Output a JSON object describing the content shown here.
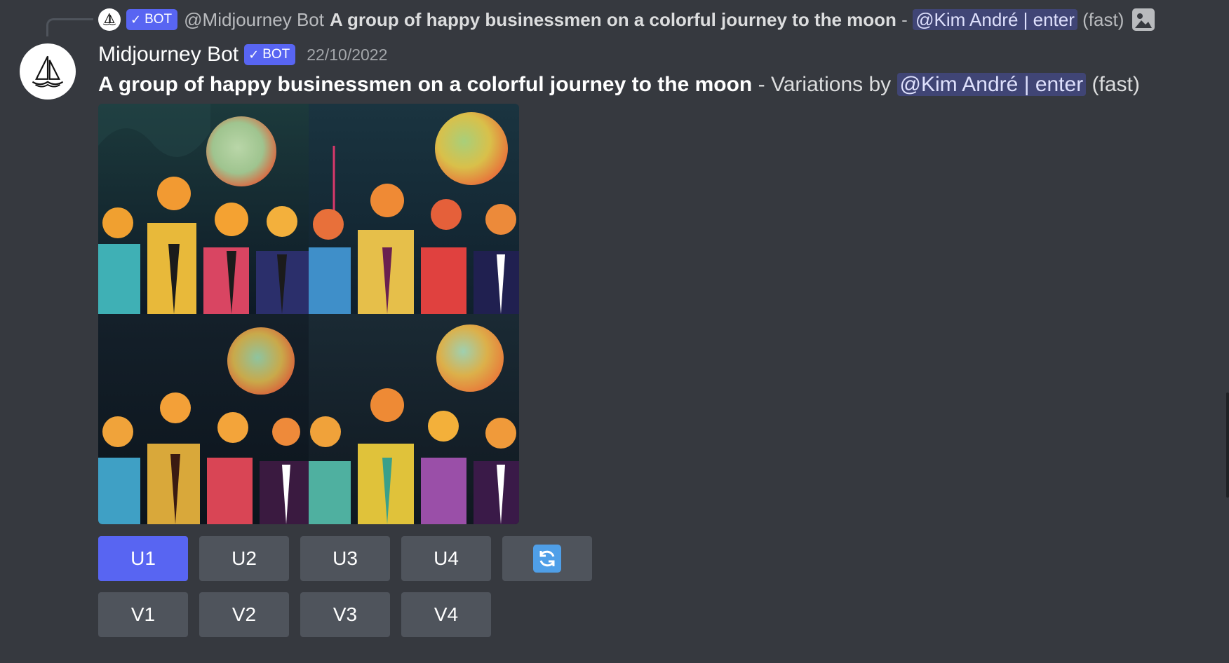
{
  "reply": {
    "bot_badge": "BOT",
    "author": "@Midjourney Bot",
    "prompt": "A group of happy businessmen on a colorful journey to the moon",
    "separator": "-",
    "mention": "@Kim André | enter",
    "speed": "(fast)"
  },
  "message": {
    "username": "Midjourney Bot",
    "bot_badge": "BOT",
    "timestamp": "22/10/2022",
    "prompt": "A group of happy businessmen on a colorful journey to the moon",
    "separator": "-",
    "variations_text": "Variations by",
    "mention": "@Kim André | enter",
    "speed": "(fast)"
  },
  "colors": {
    "background": "#36393f",
    "accent": "#5865f2",
    "button": "#4f545c",
    "mention_bg": "rgba(88,101,242,0.3)"
  },
  "buttons": {
    "upscale": [
      "U1",
      "U2",
      "U3",
      "U4"
    ],
    "variation": [
      "V1",
      "V2",
      "V3",
      "V4"
    ],
    "reroll_icon": "refresh-icon"
  }
}
